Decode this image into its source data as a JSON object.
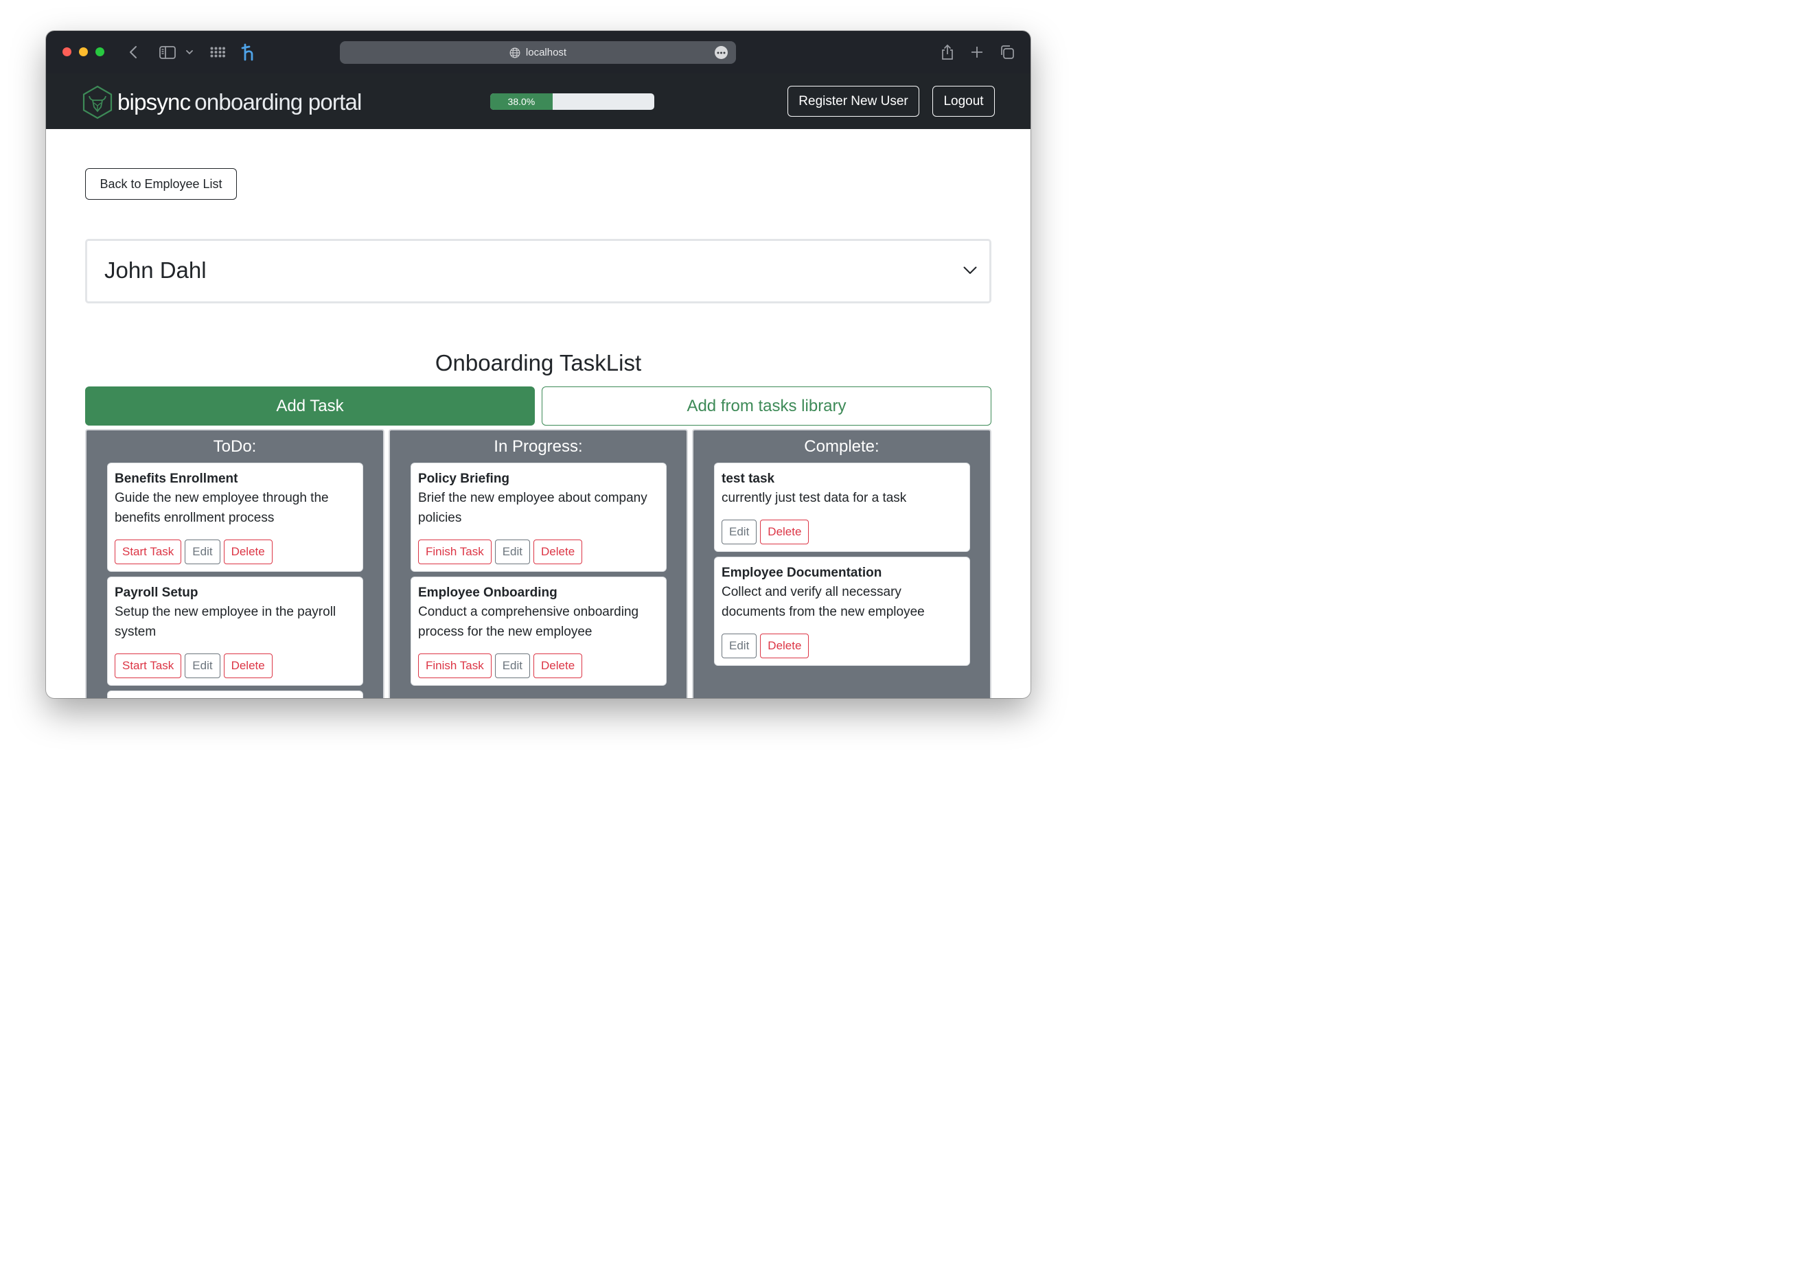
{
  "browser": {
    "url": "localhost"
  },
  "navbar": {
    "brand_name": "bipsync",
    "brand_sub": "onboarding portal",
    "progress_label": "38.0%",
    "progress_value": 38.0,
    "register_label": "Register New User",
    "logout_label": "Logout"
  },
  "main": {
    "back_label": "Back to Employee List",
    "employee_name": "John Dahl",
    "tasklist_title": "Onboarding TaskList",
    "add_task_label": "Add Task",
    "add_library_label": "Add from tasks library"
  },
  "columns": {
    "todo": {
      "title": "ToDo:",
      "cards": [
        {
          "title": "Benefits Enrollment",
          "desc": "Guide the new employee through the benefits enrollment process",
          "action": "Start Task",
          "edit": "Edit",
          "delete": "Delete"
        },
        {
          "title": "Payroll Setup",
          "desc": "Setup the new employee in the payroll system",
          "action": "Start Task",
          "edit": "Edit",
          "delete": "Delete"
        }
      ]
    },
    "progress": {
      "title": "In Progress:",
      "cards": [
        {
          "title": "Policy Briefing",
          "desc": "Brief the new employee about company policies",
          "action": "Finish Task",
          "edit": "Edit",
          "delete": "Delete"
        },
        {
          "title": "Employee Onboarding",
          "desc": "Conduct a comprehensive onboarding process for the new employee",
          "action": "Finish Task",
          "edit": "Edit",
          "delete": "Delete"
        }
      ]
    },
    "complete": {
      "title": "Complete:",
      "cards": [
        {
          "title": "test task",
          "desc": "currently just test data for a task",
          "edit": "Edit",
          "delete": "Delete"
        },
        {
          "title": "Employee Documentation",
          "desc": "Collect and verify all necessary documents from the new employee",
          "edit": "Edit",
          "delete": "Delete"
        }
      ]
    }
  },
  "colors": {
    "navbar_bg": "#212529",
    "accent_green": "#3d8a57",
    "danger_red": "#dc3545",
    "column_gray": "#6c737b"
  }
}
